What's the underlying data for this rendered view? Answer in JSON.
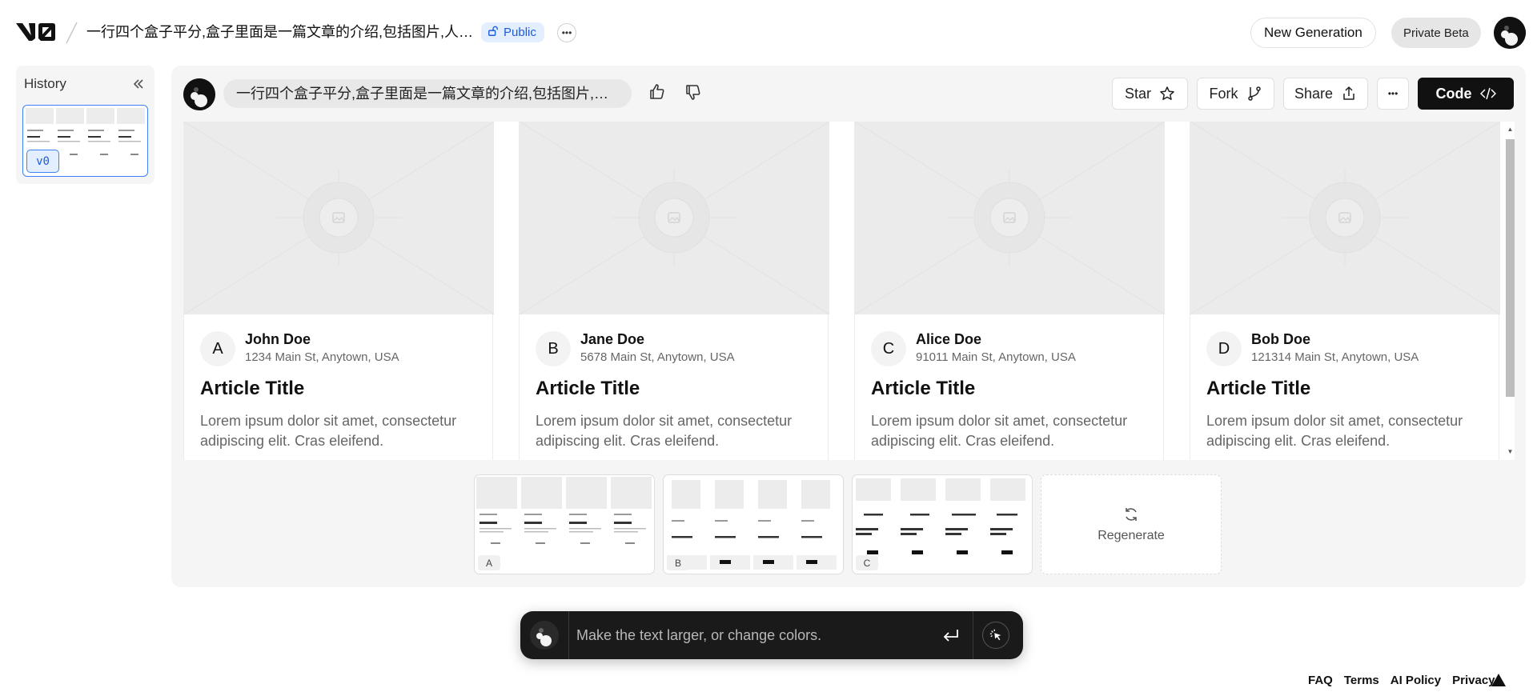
{
  "header": {
    "project_title": "一行四个盒子平分,盒子里面是一篇文章的介绍,包括图片,人员...",
    "visibility": "Public",
    "new_generation": "New Generation",
    "private_beta": "Private Beta"
  },
  "history": {
    "title": "History",
    "version_label": "v0"
  },
  "message": {
    "text": "一行四个盒子平分,盒子里面是一篇文章的介绍,包括图片,人员..."
  },
  "toolbar": {
    "star": "Star",
    "fork": "Fork",
    "share": "Share",
    "code": "Code"
  },
  "cards": [
    {
      "letter": "A",
      "name": "John Doe",
      "address": "1234 Main St, Anytown, USA",
      "title": "Article Title",
      "text": "Lorem ipsum dolor sit amet, consectetur adipiscing elit. Cras eleifend."
    },
    {
      "letter": "B",
      "name": "Jane Doe",
      "address": "5678 Main St, Anytown, USA",
      "title": "Article Title",
      "text": "Lorem ipsum dolor sit amet, consectetur adipiscing elit. Cras eleifend."
    },
    {
      "letter": "C",
      "name": "Alice Doe",
      "address": "91011 Main St, Anytown, USA",
      "title": "Article Title",
      "text": "Lorem ipsum dolor sit amet, consectetur adipiscing elit. Cras eleifend."
    },
    {
      "letter": "D",
      "name": "Bob Doe",
      "address": "121314 Main St, Anytown, USA",
      "title": "Article Title",
      "text": "Lorem ipsum dolor sit amet, consectetur adipiscing elit. Cras eleifend."
    }
  ],
  "variants": [
    {
      "label": "A"
    },
    {
      "label": "B"
    },
    {
      "label": "C"
    }
  ],
  "regenerate": "Regenerate",
  "prompt": {
    "placeholder": "Make the text larger, or change colors."
  },
  "footer": {
    "links": [
      "FAQ",
      "Terms",
      "AI Policy",
      "Privacy"
    ]
  },
  "colors": {
    "accent_blue": "#1e5bd8",
    "badge_bg": "#e3efff",
    "dark": "#111111",
    "panel_bg": "#f5f5f5"
  }
}
